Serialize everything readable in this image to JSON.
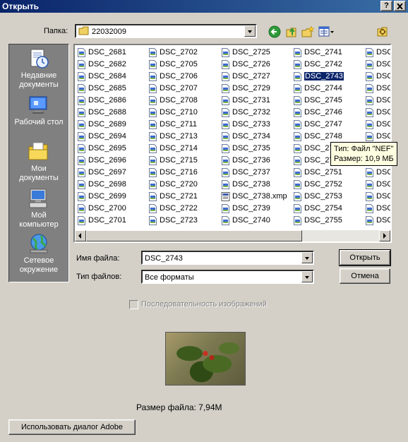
{
  "window": {
    "title": "Открыть",
    "help_btn": "?",
    "close_btn": "X"
  },
  "toolbar": {
    "folder_label": "Папка:",
    "folder_value": "22032009",
    "icons": [
      "back-icon",
      "up-folder-icon",
      "new-folder-icon",
      "view-menu-icon",
      "tools-icon"
    ]
  },
  "places": [
    {
      "name": "recent",
      "label_line1": "Недавние",
      "label_line2": "документы",
      "icon": "recent-documents-icon"
    },
    {
      "name": "desktop",
      "label_line1": "Рабочий стол",
      "label_line2": "",
      "icon": "desktop-icon"
    },
    {
      "name": "mydocs",
      "label_line1": "Мои",
      "label_line2": "документы",
      "icon": "my-documents-icon"
    },
    {
      "name": "computer",
      "label_line1": "Мой",
      "label_line2": "компьютер",
      "icon": "my-computer-icon"
    },
    {
      "name": "network",
      "label_line1": "Сетевое",
      "label_line2": "окружение",
      "icon": "network-icon"
    }
  ],
  "files": {
    "col1": [
      "DSC_2681",
      "DSC_2682",
      "DSC_2684",
      "DSC_2685",
      "DSC_2686",
      "DSC_2688",
      "DSC_2689",
      "DSC_2694",
      "DSC_2695",
      "DSC_2696",
      "DSC_2697",
      "DSC_2698",
      "DSC_2699",
      "DSC_2700",
      "DSC_2701"
    ],
    "col2": [
      "DSC_2702",
      "DSC_2705",
      "DSC_2706",
      "DSC_2707",
      "DSC_2708",
      "DSC_2710",
      "DSC_2711",
      "DSC_2713",
      "DSC_2714",
      "DSC_2715",
      "DSC_2716",
      "DSC_2720",
      "DSC_2721",
      "DSC_2722",
      "DSC_2723"
    ],
    "col3": [
      "DSC_2725",
      "DSC_2726",
      "DSC_2727",
      "DSC_2729",
      "DSC_2731",
      "DSC_2732",
      "DSC_2733",
      "DSC_2734",
      "DSC_2735",
      "DSC_2736",
      "DSC_2737",
      "DSC_2738",
      "DSC_2738.xmp",
      "DSC_2739",
      "DSC_2740"
    ],
    "col4": [
      "DSC_2741",
      "DSC_2742",
      "DSC_2743",
      "DSC_2744",
      "DSC_2745",
      "DSC_2746",
      "DSC_2747",
      "DSC_2748",
      "DSC_27",
      "DSC_27",
      "DSC_2751",
      "DSC_2752",
      "DSC_2753",
      "DSC_2754",
      "DSC_2755"
    ],
    "col5": [
      "DSC",
      "DSC",
      "DSC",
      "DSC",
      "DSC",
      "DSC",
      "DSC",
      "DSC",
      "DSC",
      "DSC",
      "DSC",
      "DSC",
      "DSC",
      "DSC",
      "DSC"
    ],
    "selected": "DSC_2743"
  },
  "tooltip": {
    "line1": "Тип: Файл \"NEF\"",
    "line2": "Размер: 10,9 МБ"
  },
  "form": {
    "filename_label": "Имя файла:",
    "filename_value": "DSC_2743",
    "filetype_label": "Тип файлов:",
    "filetype_value": "Все форматы",
    "open_btn": "Открыть",
    "cancel_btn": "Отмена",
    "sequence_label": "Последовательность изображений"
  },
  "preview": {
    "filesize": "Размер файла: 7,94M"
  },
  "adobe_btn": "Использовать диалог Adobe",
  "colors": {
    "titlebar": "#0a246a",
    "selection": "#0a246a",
    "tooltip_bg": "#ffffe1",
    "dialog_bg": "#d4d0c8"
  }
}
